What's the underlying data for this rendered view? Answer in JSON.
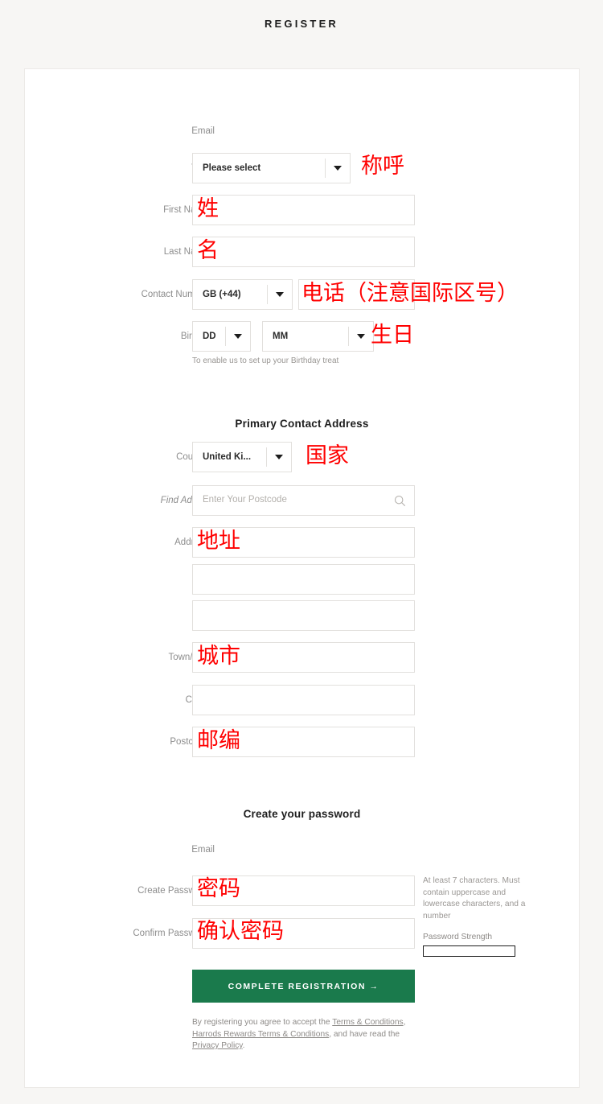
{
  "page": {
    "title": "REGISTER"
  },
  "personal": {
    "email_label": "Email",
    "title_label": "Title *",
    "title_value": "Please select",
    "first_name_label": "First Name *",
    "last_name_label": "Last Name *",
    "contact_number_label": "Contact Number *",
    "contact_code_value": "GB (+44)",
    "birthday_label": "Birthday",
    "birthday_day_value": "DD",
    "birthday_month_value": "MM",
    "birthday_helper": "To enable us to set up your Birthday treat"
  },
  "address": {
    "heading": "Primary Contact Address",
    "country_label": "Country *",
    "country_value": "United Ki...",
    "find_address_label": "Find Address",
    "find_address_placeholder": "Enter Your Postcode",
    "search_icon": "search-icon",
    "address_label": "Address *",
    "town_label": "Town/City *",
    "county_label": "County",
    "postcode_label": "Postcode *"
  },
  "password": {
    "heading": "Create your password",
    "email_label": "Email",
    "create_label": "Create Password *",
    "confirm_label": "Confirm Password *",
    "requirements": "At least 7 characters. Must contain uppercase and lowercase characters, and a number",
    "strength_label": "Password Strength"
  },
  "submit": {
    "label": "COMPLETE REGISTRATION →"
  },
  "terms": {
    "prefix": "By registering you agree to accept the ",
    "link1": "Terms & Conditions",
    "mid1": ", ",
    "link2": "Harrods Rewards Terms & Conditions",
    "mid2": ", and have read the ",
    "link3": "Privacy Policy",
    "suffix": "."
  },
  "annotations": {
    "title": "称呼",
    "first_name": "姓",
    "last_name": "名",
    "contact_number": "电话（注意国际区号）",
    "birthday": "生日",
    "country": "国家",
    "address": "地址",
    "town": "城市",
    "postcode": "邮编",
    "password": "密码",
    "confirm_password": "确认密码"
  },
  "colors": {
    "accent_green": "#1a7a4c",
    "annotation_red": "#ff0000",
    "page_background": "#f7f6f4",
    "card_background": "#ffffff",
    "border": "#e2e0dd"
  }
}
